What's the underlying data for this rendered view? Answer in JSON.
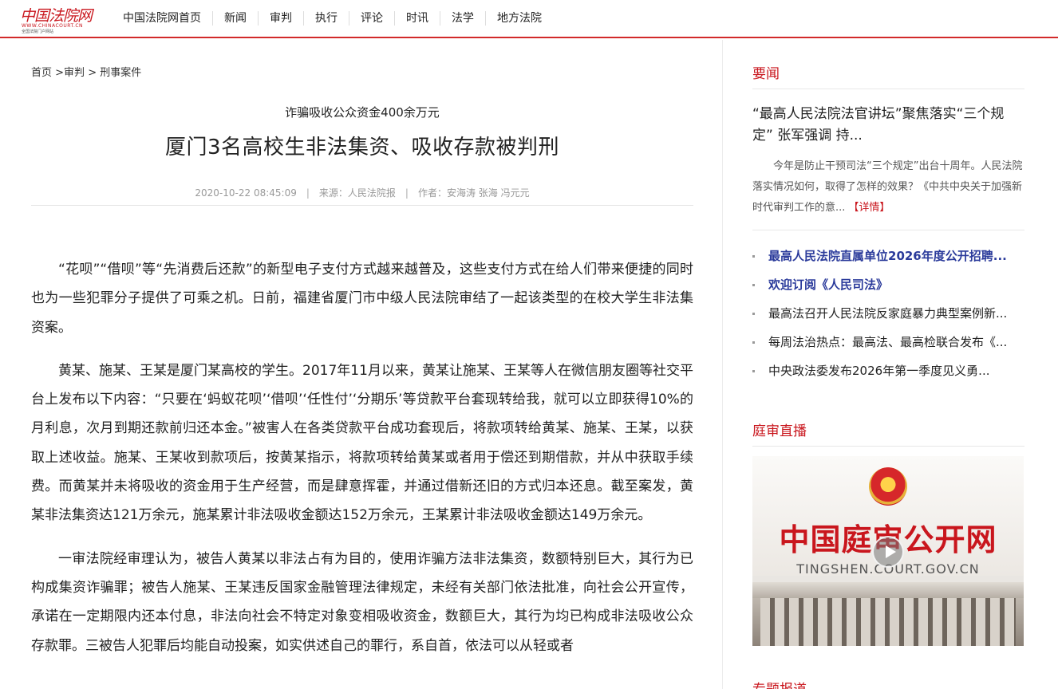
{
  "header": {
    "logo_text": "中国法院网",
    "logo_url": "WWW.CHINACOURT.CN",
    "logo_sub": "全国法院门户网站",
    "nav": [
      "中国法院网首页",
      "新闻",
      "审判",
      "执行",
      "评论",
      "时讯",
      "法学",
      "地方法院"
    ]
  },
  "breadcrumb": {
    "home": "首页",
    "sep1": " >",
    "trial": "审判",
    "sep2": " > ",
    "category": "刑事案件"
  },
  "article": {
    "subtitle": "诈骗吸收公众资金400余万元",
    "title": "厦门3名高校生非法集资、吸收存款被判刑",
    "date": "2020-10-22 08:45:09",
    "source": "来源：人民法院报",
    "author": "作者：安海涛 张海 冯元元",
    "paragraphs": [
      "“花呗”“借呗”等“先消费后还款”的新型电子支付方式越来越普及，这些支付方式在给人们带来便捷的同时也为一些犯罪分子提供了可乘之机。日前，福建省厦门市中级人民法院审结了一起该类型的在校大学生非法集资案。",
      "黄某、施某、王某是厦门某高校的学生。2017年11月以来，黄某让施某、王某等人在微信朋友圈等社交平台上发布以下内容：“只要在‘蚂蚁花呗’‘借呗’‘任性付’‘分期乐’等贷款平台套现转给我，就可以立即获得10%的月利息，次月到期还款前归还本金。”被害人在各类贷款平台成功套现后，将款项转给黄某、施某、王某，以获取上述收益。施某、王某收到款项后，按黄某指示，将款项转给黄某或者用于偿还到期借款，并从中获取手续费。而黄某并未将吸收的资金用于生产经营，而是肆意挥霍，并通过借新还旧的方式归本还息。截至案发，黄某非法集资达121万余元，施某累计非法吸收金额达152万余元，王某累计非法吸收金额达149万余元。",
      "一审法院经审理认为，被告人黄某以非法占有为目的，使用诈骗方法非法集资，数额特别巨大，其行为已构成集资诈骗罪；被告人施某、王某违反国家金融管理法律规定，未经有关部门依法批准，向社会公开宣传，承诺在一定期限内还本付息，非法向社会不特定对象变相吸收资金，数额巨大，其行为均已构成非法吸收公众存款罪。三被告人犯罪后均能自动投案，如实供述自己的罪行，系自首，依法可以从轻或者"
    ]
  },
  "sidebar": {
    "news_title": "要闻",
    "headline": "“最高人民法院法官讲坛”聚焦落实“三个规定” 张军强调 持...",
    "summary": "今年是防止干预司法“三个规定”出台十周年。人民法院落实情况如何，取得了怎样的效果？《中共中央关于加强新时代审判工作的意...",
    "detail_link": "【详情】",
    "list": [
      "最高人民法院直属单位2026年度公开招聘...",
      "欢迎订阅《人民司法》",
      "最高法召开人民法院反家庭暴力典型案例新...",
      "每周法治热点：最高法、最高检联合发布《...",
      "中央政法委发布2026年第一季度见义勇..."
    ],
    "live_title": "庭审直播",
    "live_name": "中国庭审公开网",
    "live_url": "TINGSHEN.COURT.GOV.CN",
    "next_section": "专题报道"
  }
}
